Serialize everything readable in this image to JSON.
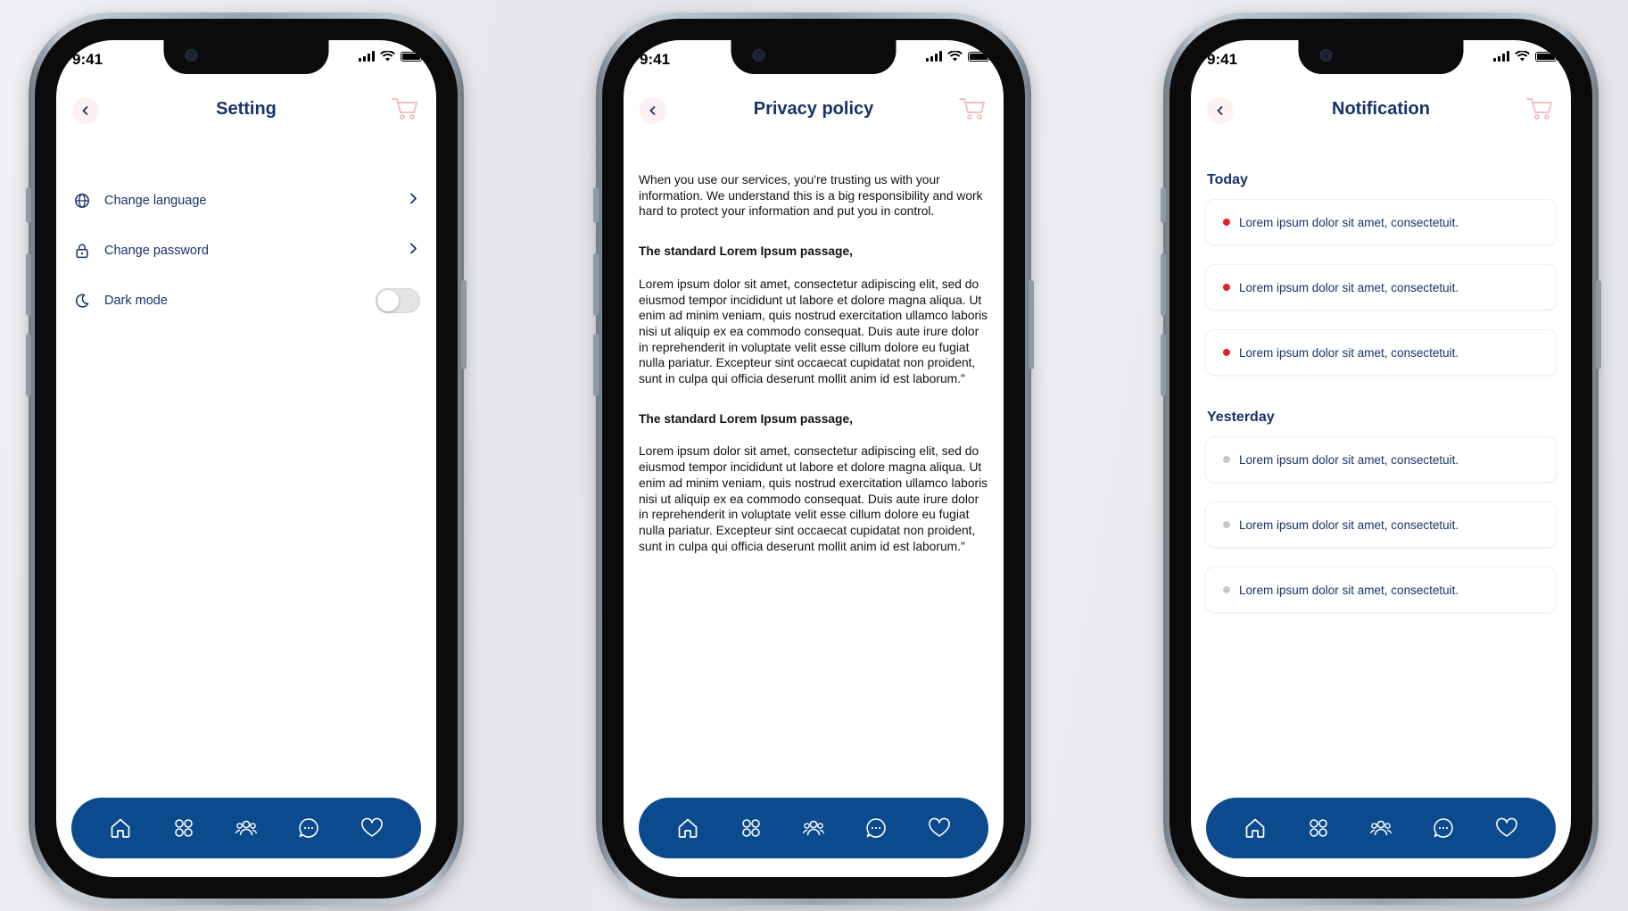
{
  "colors": {
    "navy": "#17336a",
    "tabbar": "#0b4a8c",
    "unread_dot": "#e2212c",
    "read_dot": "#c8c8cc",
    "cart": "#f3b7b7"
  },
  "status_bar": {
    "time": "9:41"
  },
  "tabbar": {
    "icons": [
      "home-icon",
      "grid-icon",
      "users-icon",
      "chat-icon",
      "heart-icon"
    ]
  },
  "settings_screen": {
    "title": "Setting",
    "items": [
      {
        "label": "Change language",
        "icon": "globe-icon",
        "control": "chevron"
      },
      {
        "label": "Change password",
        "icon": "lock-icon",
        "control": "chevron"
      },
      {
        "label": "Dark mode",
        "icon": "moon-icon",
        "control": "toggle",
        "toggle_on": false
      }
    ]
  },
  "privacy_screen": {
    "title": "Privacy policy",
    "intro": "When you use our services, you're trusting us with your information. We understand this is a big responsibility and work hard to protect your information and put you in control.",
    "sections": [
      {
        "heading": "The standard Lorem Ipsum passage,",
        "body": "Lorem ipsum dolor sit amet, consectetur adipiscing elit, sed do eiusmod tempor incididunt ut labore et dolore magna aliqua. Ut enim ad minim veniam, quis nostrud exercitation ullamco laboris nisi ut aliquip ex ea commodo consequat. Duis aute irure dolor in reprehenderit in voluptate velit esse cillum dolore eu fugiat nulla pariatur. Excepteur sint occaecat cupidatat non proident, sunt in culpa qui officia deserunt mollit anim id est laborum.\""
      },
      {
        "heading": "The standard Lorem Ipsum passage,",
        "body": "Lorem ipsum dolor sit amet, consectetur adipiscing elit, sed do eiusmod tempor incididunt ut labore et dolore magna aliqua. Ut enim ad minim veniam, quis nostrud exercitation ullamco laboris nisi ut aliquip ex ea commodo consequat. Duis aute irure dolor in reprehenderit in voluptate velit esse cillum dolore eu fugiat nulla pariatur. Excepteur sint occaecat cupidatat non proident, sunt in culpa qui officia deserunt mollit anim id est laborum.\""
      }
    ]
  },
  "notification_screen": {
    "title": "Notification",
    "groups": [
      {
        "label": "Today",
        "items": [
          {
            "text": "Lorem ipsum dolor sit amet, consectetuit.",
            "unread": true
          },
          {
            "text": "Lorem ipsum dolor sit amet, consectetuit.",
            "unread": true
          },
          {
            "text": "Lorem ipsum dolor sit amet, consectetuit.",
            "unread": true
          }
        ]
      },
      {
        "label": "Yesterday",
        "items": [
          {
            "text": "Lorem ipsum dolor sit amet, consectetuit.",
            "unread": false
          },
          {
            "text": "Lorem ipsum dolor sit amet, consectetuit.",
            "unread": false
          },
          {
            "text": "Lorem ipsum dolor sit amet, consectetuit.",
            "unread": false
          }
        ]
      }
    ]
  }
}
